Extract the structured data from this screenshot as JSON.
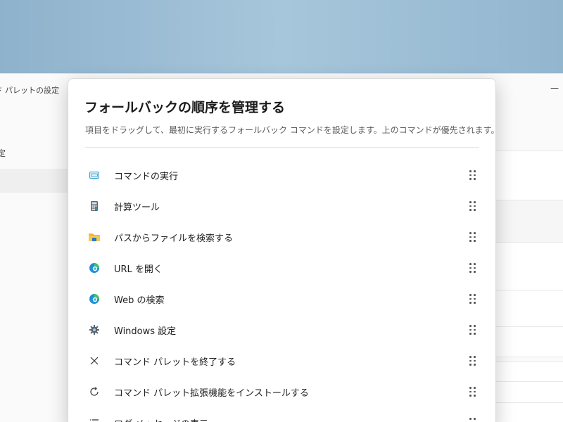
{
  "background_window": {
    "title": "コマンド パレットの設定",
    "sidebar_label": "設定",
    "minimize_glyph": "—"
  },
  "modal": {
    "title": "フォールバックの順序を管理する",
    "description": "項目をドラッグして、最初に実行するフォールバック コマンドを設定します。上のコマンドが優先されます。",
    "items": [
      {
        "label": "コマンドの実行",
        "icon": "terminal-icon"
      },
      {
        "label": "計算ツール",
        "icon": "calculator-icon"
      },
      {
        "label": "パスからファイルを検索する",
        "icon": "folder-icon"
      },
      {
        "label": "URL を開く",
        "icon": "edge-icon"
      },
      {
        "label": "Web の検索",
        "icon": "edge-icon"
      },
      {
        "label": "Windows 設定",
        "icon": "gear-icon"
      },
      {
        "label": "コマンド パレットを終了する",
        "icon": "close-icon"
      },
      {
        "label": "コマンド パレット拡張機能をインストールする",
        "icon": "refresh-icon"
      },
      {
        "label": "ログ メッセージの表示",
        "icon": "list-icon"
      }
    ]
  },
  "colors": {
    "accent": "#0067c0",
    "folder": "#f2b632",
    "text": "#1f1f1f",
    "muted": "#5b5b5b"
  }
}
